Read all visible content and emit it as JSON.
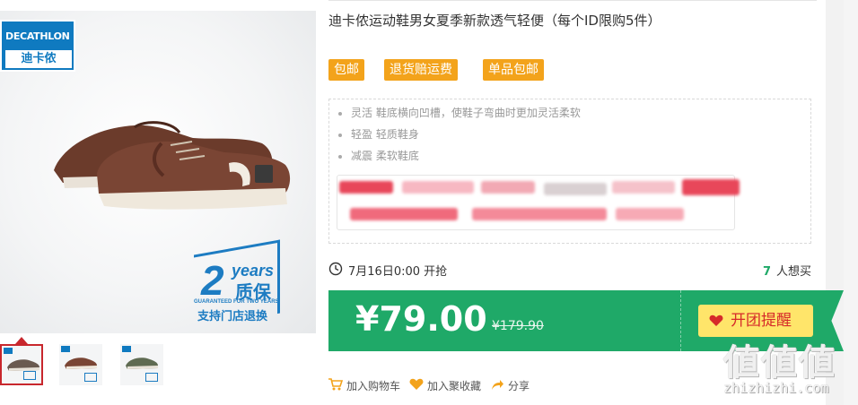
{
  "product": {
    "title": "迪卡侬运动鞋男女夏季新款透气轻便（每个ID限购5件）",
    "tags": [
      "包邮",
      "退货赔运费",
      "单品包邮"
    ],
    "features": [
      "灵活 鞋底横向凹槽，使鞋子弯曲时更加灵活柔软",
      "轻盈 轻质鞋身",
      "减震 柔软鞋底"
    ]
  },
  "gallery": {
    "brand_en": "DECATHLON",
    "brand_cn": "迪卡侬",
    "warranty_number": "2",
    "warranty_years": "years",
    "warranty_cn": "质保",
    "warranty_en": "GUARANTEED FOR TWO YEARS",
    "warranty_store": "支持门店退换"
  },
  "sale": {
    "time_label": "7月16日0:00 开抢",
    "want_count": "7",
    "want_label": "人想买",
    "price": "¥79.00",
    "original_price": "¥179.90",
    "remind_label": "开团提醒"
  },
  "actions": {
    "cart": "加入购物车",
    "favorite": "加入聚收藏",
    "share": "分享"
  },
  "watermark": {
    "logo": "値値値",
    "domain": "zhizhizhi.com"
  },
  "colors": {
    "accent_green": "#1fa968",
    "tag_orange": "#f3a31b",
    "remind_yellow": "#ffe56a",
    "brand_blue": "#0f7ac0"
  }
}
